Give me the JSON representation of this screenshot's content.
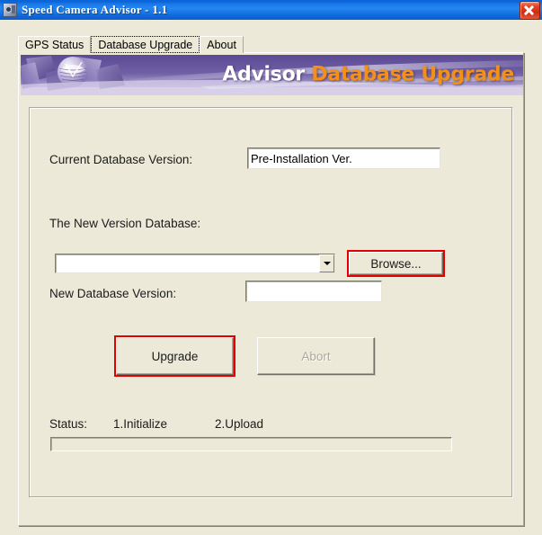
{
  "window": {
    "title": "Speed Camera Advisor - 1.1",
    "app_icon": "app-icon",
    "close_label": "close-icon",
    "title_bar_color": "#0b64d8",
    "form_color": "#ece9d8"
  },
  "tabs": [
    {
      "label": "GPS Status",
      "selected": false
    },
    {
      "label": "Database Upgrade",
      "selected": true
    },
    {
      "label": "About",
      "selected": false
    }
  ],
  "banner": {
    "title_white": "Advisor",
    "title_orange": "Database Upgrade",
    "orange": "#f3901a",
    "purple_dark": "#4a3a80",
    "purple_light": "#c9bfe2"
  },
  "form": {
    "current_version_label": "Current Database Version:",
    "current_version_value": "Pre-Installation Ver.",
    "new_version_db_label": "The New Version Database:",
    "database_path_value": "",
    "database_path_placeholder": "",
    "new_db_version_label": "New Database Version:",
    "new_db_version_value": "",
    "browse_label": "Browse...",
    "upgrade_label": "Upgrade",
    "abort_label": "Abort",
    "abort_enabled": false
  },
  "status": {
    "label": "Status:",
    "step1": "1.Initialize",
    "step2": "2.Upload",
    "progress_percent": 0
  },
  "annotations": {
    "highlight_color": "#e40000",
    "highlighted": [
      "browse-button",
      "upgrade-button"
    ]
  }
}
